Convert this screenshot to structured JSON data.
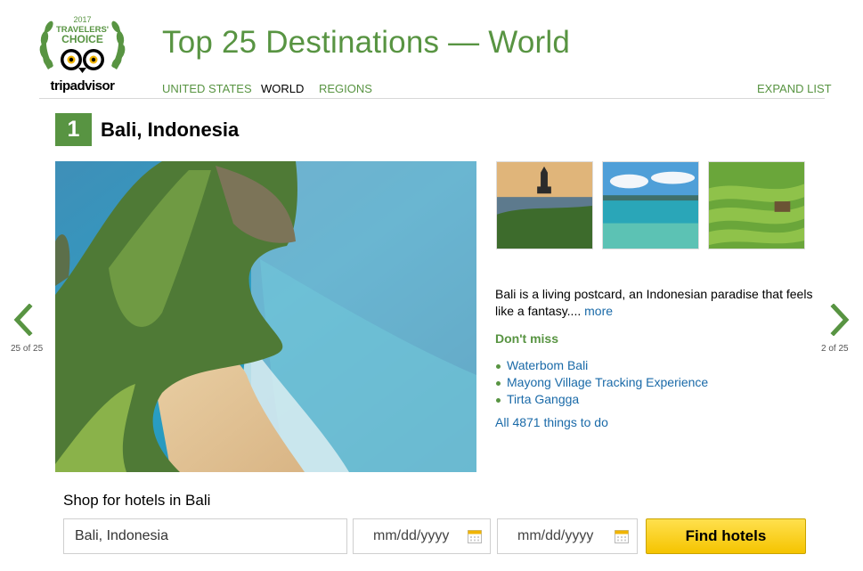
{
  "logo": {
    "year": "2017",
    "award_line1": "TRAVELERS'",
    "award_line2": "CHOICE",
    "wordmark_part1": "trip",
    "wordmark_part2": "advisor",
    "icon": "owl-logo-icon"
  },
  "header": {
    "title": "Top 25 Destinations — World",
    "nav": [
      "UNITED STATES",
      "WORLD",
      "REGIONS"
    ],
    "active_nav": "WORLD",
    "expand_list": "EXPAND LIST"
  },
  "destination": {
    "rank": "1",
    "name": "Bali, Indonesia",
    "description": "Bali is a living postcard, an Indonesian paradise that feels like a fantasy....",
    "more_link": "more",
    "dont_miss_label": "Don't miss",
    "attractions": [
      "Waterbom Bali",
      "Mayong Village Tracking Experience",
      "Tirta Gangga"
    ],
    "all_things": "All 4871 things to do"
  },
  "carousel": {
    "prev_counter": "25 of 25",
    "next_counter": "2 of 25",
    "prev_icon": "chevron-left-icon",
    "next_icon": "chevron-right-icon"
  },
  "hotel_search": {
    "label": "Shop for hotels in Bali",
    "destination_value": "Bali, Indonesia",
    "checkin_placeholder": "mm/dd/yyyy",
    "checkout_placeholder": "mm/dd/yyyy",
    "button": "Find hotels",
    "calendar_icon": "calendar-icon"
  },
  "colors": {
    "brand_green": "#589442",
    "link_blue": "#1a6aa8",
    "button_yellow": "#f5c400"
  }
}
